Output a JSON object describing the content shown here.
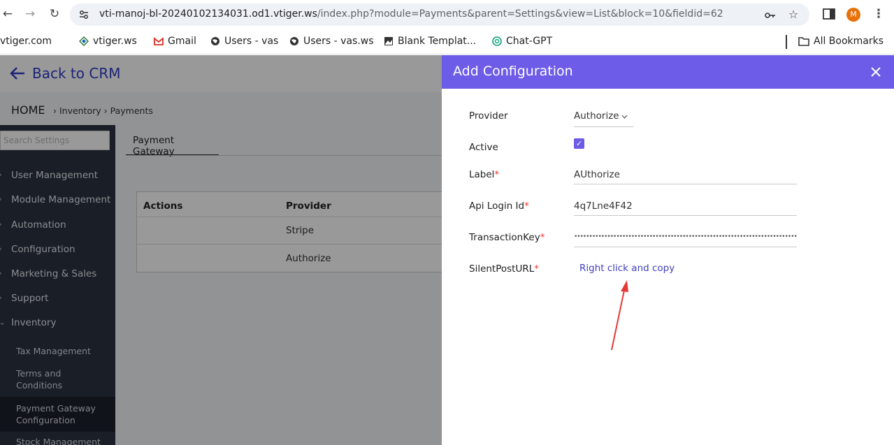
{
  "browser": {
    "url_host": "vti-manoj-bl-20240102134031.od1.vtiger.ws",
    "url_path": "/index.php?module=Payments&parent=Settings&view=List&block=10&fieldid=62",
    "avatar_initial": "M",
    "bookmarks": [
      "vtiger.com",
      "vtiger.ws",
      "Gmail",
      "Users - vas",
      "Users - vas.ws",
      "Blank Templat...",
      "Chat-GPT",
      "All Bookmarks"
    ]
  },
  "app": {
    "back_label": "Back to CRM",
    "breadcrumb": {
      "home": "HOME",
      "path": "› Inventory › Payments"
    },
    "search_placeholder": "Search Settings",
    "sidebar": {
      "sections": [
        "User Management",
        "Module Management",
        "Automation",
        "Configuration",
        "Marketing & Sales",
        "Support",
        "Inventory"
      ],
      "sub_items": [
        "Tax Management",
        "Terms and Conditions",
        "Payment Gateway Configuration",
        "Stock Management"
      ]
    },
    "tab_label": "Payment Gateway",
    "table": {
      "headers": [
        "Actions",
        "Provider"
      ],
      "rows": [
        {
          "provider": "Stripe"
        },
        {
          "provider": "Authorize"
        }
      ]
    }
  },
  "modal": {
    "title": "Add Configuration",
    "fields": {
      "provider_label": "Provider",
      "provider_value": "Authorize",
      "active_label": "Active",
      "label_label": "Label",
      "label_value": "AUthorize",
      "api_label": "Api Login Id",
      "api_value": "4q7Lne4F42",
      "txn_label": "TransactionKey",
      "txn_mask": "••••••••••••••••••••••••••••••••••••••••••••••••••••••••••••••••••••••••••••••••••••••••••••",
      "silent_label": "SilentPostURL",
      "silent_link": "Right click and copy"
    },
    "required_mark": "*",
    "accent_color": "#6c5ce7",
    "annotation_color": "#e53935"
  }
}
